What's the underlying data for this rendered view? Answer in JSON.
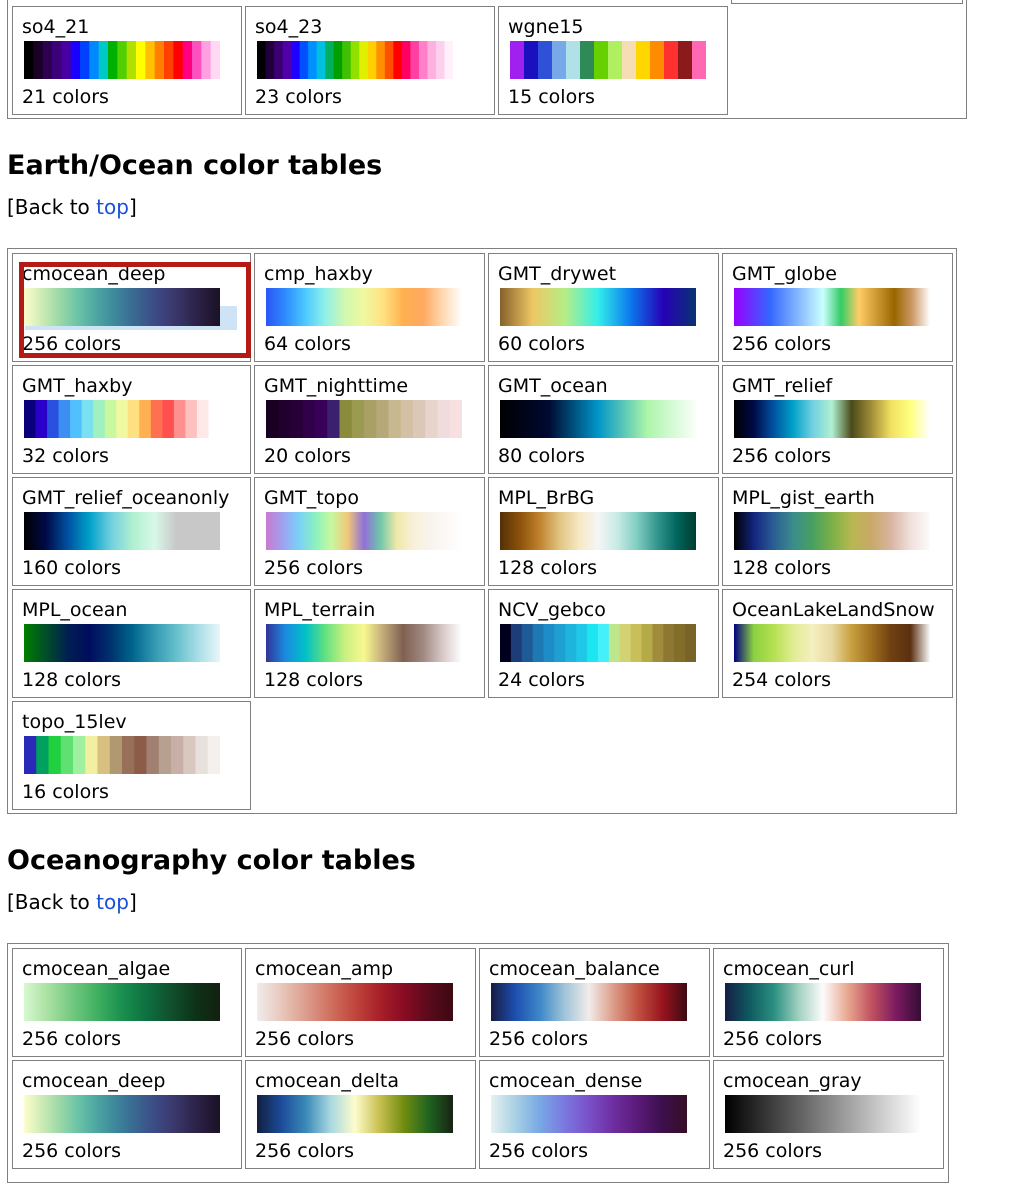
{
  "top_tables": [
    {
      "name": "so4_21",
      "count": "21 colors",
      "colors": [
        "#000000",
        "#1b0026",
        "#2e0050",
        "#3c0078",
        "#4800a0",
        "#1a00ff",
        "#0040ff",
        "#0088ff",
        "#00c8c8",
        "#00b000",
        "#50d000",
        "#b0e000",
        "#ffff00",
        "#ffc000",
        "#ff8000",
        "#ff4000",
        "#ff0000",
        "#ff0080",
        "#ff50c0",
        "#ffa0e0",
        "#ffd8f4"
      ],
      "fill": 1.0
    },
    {
      "name": "so4_23",
      "count": "23 colors",
      "colors": [
        "#000000",
        "#20003a",
        "#3a0070",
        "#5000a8",
        "#2000ff",
        "#0050ff",
        "#0090ff",
        "#00c0e0",
        "#00b060",
        "#00a000",
        "#40c000",
        "#90e000",
        "#e0f000",
        "#ffd000",
        "#ff9000",
        "#ff5000",
        "#ff0000",
        "#ff0060",
        "#ff40a0",
        "#ff80c8",
        "#ffb0e0",
        "#ffd0ee",
        "#fff0fa"
      ],
      "fill": 1.0
    },
    {
      "name": "wgne15",
      "count": "15 colors",
      "colors": [
        "#a020f0",
        "#1a10c0",
        "#3050d8",
        "#78a8e8",
        "#b0e0e8",
        "#2e8b57",
        "#66d000",
        "#b0f060",
        "#f5deb3",
        "#ffd700",
        "#ff8c00",
        "#ff3030",
        "#8b1a1a",
        "#ff69b4"
      ],
      "fill": 1.0
    }
  ],
  "sections": [
    {
      "title": "Earth/Ocean color tables",
      "back_prefix": "[Back to ",
      "back_link": "top",
      "back_suffix": "]",
      "tables": [
        {
          "name": "cmocean_deep",
          "count": "256 colors",
          "colors": [
            "#fdfecc",
            "#cdebb4",
            "#9cd8a8",
            "#6cc4a6",
            "#4ea8a2",
            "#3e8b9c",
            "#3a6e94",
            "#3c538a",
            "#3d3f77",
            "#332e5c",
            "#281d3f",
            "#1a1224"
          ],
          "smooth": true,
          "fill": 1.0,
          "highlight": true
        },
        {
          "name": "cmp_haxby",
          "count": "64 colors",
          "colors": [
            "#2a56f5",
            "#2f8cff",
            "#4cc8ff",
            "#8ff0e8",
            "#d0f8b0",
            "#f0f8a0",
            "#ffe080",
            "#ffb050",
            "#ffa860",
            "#ffd8b0",
            "#ffffff"
          ],
          "smooth": true,
          "fill": 1.0
        },
        {
          "name": "GMT_drywet",
          "count": "60 colors",
          "colors": [
            "#86612a",
            "#eec764",
            "#b4ee87",
            "#32eeeb",
            "#0c78ee",
            "#2601b7",
            "#083371"
          ],
          "smooth": true,
          "fill": 1.0
        },
        {
          "name": "GMT_globe",
          "count": "256 colors",
          "colors": [
            "#9900ff",
            "#6633ff",
            "#3366ff",
            "#6699ff",
            "#99ccff",
            "#ccffff",
            "#33cc66",
            "#ffcc66",
            "#cc9933",
            "#996600",
            "#cc9966",
            "#ffffff"
          ],
          "smooth": true,
          "fill": 1.0
        },
        {
          "name": "GMT_haxby",
          "count": "32 colors",
          "colors": [
            "#0a0079",
            "#2800c8",
            "#2a50e0",
            "#3c8ff0",
            "#50c0ff",
            "#78e0f0",
            "#a0f0c0",
            "#c8f8a0",
            "#f0f8a0",
            "#ffe080",
            "#ffb050",
            "#ff7050",
            "#ff5050",
            "#ff9090",
            "#ffc0c0",
            "#ffe8e8",
            "#ffffff"
          ],
          "fill": 1.0
        },
        {
          "name": "GMT_nighttime",
          "count": "20 colors",
          "colors": [
            "#1a0020",
            "#22002e",
            "#280038",
            "#300048",
            "#380058",
            "#3c2070",
            "#8a8b3c",
            "#9a9a50",
            "#a8a064",
            "#b8a878",
            "#c8b890",
            "#d4c0a4",
            "#dcc8b8",
            "#e8d4cc",
            "#f0dcdc",
            "#f8e0e0"
          ],
          "fill": 1.0
        },
        {
          "name": "GMT_ocean",
          "count": "80 colors",
          "colors": [
            "#000000",
            "#000519",
            "#000a32",
            "#00507d",
            "#0096c8",
            "#56c5b8",
            "#acf5a8",
            "#d3fad3",
            "#fafffa"
          ],
          "smooth": true,
          "fill": 1.0
        },
        {
          "name": "GMT_relief",
          "count": "256 colors",
          "colors": [
            "#000000",
            "#000a46",
            "#0050a0",
            "#00a0c8",
            "#70d0e0",
            "#b0f0d0",
            "#4a4a18",
            "#a08c38",
            "#f0e060",
            "#ffff80",
            "#ffffff"
          ],
          "smooth": true,
          "fill": 1.0
        },
        {
          "name": "GMT_relief_oceanonly",
          "count": "160 colors",
          "colors": [
            "#000000",
            "#000a46",
            "#0050a0",
            "#00a0c8",
            "#70d0e0",
            "#b0f0d0",
            "#d8f8e8",
            "#c8c8c8",
            "#c8c8c8",
            "#c8c8c8"
          ],
          "smooth": true,
          "fill": 1.0
        },
        {
          "name": "GMT_topo",
          "count": "256 colors",
          "colors": [
            "#c87ad0",
            "#a0a0f0",
            "#7ad0f8",
            "#8af0c0",
            "#c8f8a0",
            "#f0c878",
            "#9070d8",
            "#70c8a8",
            "#f0e8a8",
            "#f8f0d8",
            "#f8f4ec",
            "#fcf8f4",
            "#ffffff"
          ],
          "smooth": true,
          "fill": 1.0
        },
        {
          "name": "MPL_BrBG",
          "count": "128 colors",
          "colors": [
            "#543005",
            "#8c510a",
            "#bf812d",
            "#dfc27d",
            "#f6e8c3",
            "#f5f5f5",
            "#c7eae5",
            "#80cdc1",
            "#35978f",
            "#01665e",
            "#003c30"
          ],
          "smooth": true,
          "fill": 1.0
        },
        {
          "name": "MPL_gist_earth",
          "count": "128 colors",
          "colors": [
            "#000000",
            "#12247e",
            "#2a5c94",
            "#3a8c8c",
            "#48a060",
            "#7ab048",
            "#b8b850",
            "#c8a868",
            "#d8b4a0",
            "#f0e0dc",
            "#fdfbfb"
          ],
          "smooth": true,
          "fill": 1.0
        },
        {
          "name": "MPL_ocean",
          "count": "128 colors",
          "colors": [
            "#007f00",
            "#004f28",
            "#001f50",
            "#000c5e",
            "#00336e",
            "#00668c",
            "#3399b2",
            "#66c0cc",
            "#aadde6",
            "#e8f6fa"
          ],
          "smooth": true,
          "fill": 1.0
        },
        {
          "name": "MPL_terrain",
          "count": "128 colors",
          "colors": [
            "#333399",
            "#1a8ce0",
            "#00c0c8",
            "#60e080",
            "#c8f080",
            "#f8f890",
            "#c0a878",
            "#806050",
            "#a08880",
            "#d8c8c8",
            "#ffffff"
          ],
          "smooth": true,
          "fill": 1.0
        },
        {
          "name": "NCV_gebco",
          "count": "24 colors",
          "colors": [
            "#00001e",
            "#1e3c78",
            "#1e5a96",
            "#1e78b4",
            "#1e8cc8",
            "#1ea0d2",
            "#1eb4dc",
            "#1ec8e6",
            "#1ee6f0",
            "#46f0fa",
            "#bee68c",
            "#d2d272",
            "#c8be5a",
            "#b4aa46",
            "#a08c3c",
            "#8c7832",
            "#826e28",
            "#786428"
          ],
          "fill": 1.0
        },
        {
          "name": "OceanLakeLandSnow",
          "count": "254 colors",
          "colors": [
            "#000080",
            "#8cd040",
            "#b4e050",
            "#e0ec90",
            "#f4f0c0",
            "#e8d8a0",
            "#c8a040",
            "#a07020",
            "#704010",
            "#5a3010",
            "#fafafa"
          ],
          "smooth": true,
          "fill": 1.0
        },
        {
          "name": "topo_15lev",
          "count": "16 colors",
          "colors": [
            "#2a2ab8",
            "#00a060",
            "#20d040",
            "#60e070",
            "#a0f0a0",
            "#f0f0a0",
            "#d8c080",
            "#b09870",
            "#987058",
            "#8c5c48",
            "#a08070",
            "#b8a090",
            "#c8b0a8",
            "#d8c8c0",
            "#e8e0dc",
            "#f4f0ee"
          ],
          "fill": 1.0
        }
      ]
    },
    {
      "title": "Oceanography color tables",
      "back_prefix": "[Back to ",
      "back_link": "top",
      "back_suffix": "]",
      "tables": [
        {
          "name": "cmocean_algae",
          "count": "256 colors",
          "colors": [
            "#d7f9d0",
            "#a8e0a0",
            "#70c880",
            "#40b060",
            "#1a9050",
            "#0e7040",
            "#10502c",
            "#0e3218",
            "#12200f"
          ],
          "smooth": true,
          "fill": 1.0
        },
        {
          "name": "cmocean_amp",
          "count": "256 colors",
          "colors": [
            "#f1ecec",
            "#e8c8bc",
            "#dc9c8c",
            "#d07060",
            "#c0463c",
            "#a82028",
            "#880c24",
            "#5a0a1c",
            "#3c0912"
          ],
          "smooth": true,
          "fill": 1.0
        },
        {
          "name": "cmocean_balance",
          "count": "256 colors",
          "colors": [
            "#181c43",
            "#1d4fb0",
            "#3e88c8",
            "#a0c4d8",
            "#f1eceb",
            "#dc9c88",
            "#c05040",
            "#98141e",
            "#3c0912"
          ],
          "smooth": true,
          "fill": 1.0
        },
        {
          "name": "cmocean_curl",
          "count": "256 colors",
          "colors": [
            "#151d44",
            "#0f5a60",
            "#2a9080",
            "#a0d0c0",
            "#fefcfc",
            "#e8a890",
            "#c05060",
            "#7a1a60",
            "#340d35"
          ],
          "smooth": true,
          "fill": 1.0
        },
        {
          "name": "cmocean_deep",
          "count": "256 colors",
          "colors": [
            "#fdfecc",
            "#cdebb4",
            "#9cd8a8",
            "#6cc4a6",
            "#4ea8a2",
            "#3e8b9c",
            "#3a6e94",
            "#3c538a",
            "#3d3f77",
            "#332e5c",
            "#281d3f",
            "#1a1224"
          ],
          "smooth": true,
          "fill": 1.0
        },
        {
          "name": "cmocean_delta",
          "count": "256 colors",
          "colors": [
            "#112040",
            "#1c4c9a",
            "#3a8ab8",
            "#a8d8e0",
            "#fefccc",
            "#c8c050",
            "#708c10",
            "#206420",
            "#172313"
          ],
          "smooth": true,
          "fill": 1.0
        },
        {
          "name": "cmocean_dense",
          "count": "256 colors",
          "colors": [
            "#e6f1f1",
            "#a8d0e4",
            "#78a8e4",
            "#7a78e0",
            "#7a50c8",
            "#6e2ea0",
            "#5a1a78",
            "#3c0f4c",
            "#360e24"
          ],
          "smooth": true,
          "fill": 1.0
        },
        {
          "name": "cmocean_gray",
          "count": "256 colors",
          "colors": [
            "#000000",
            "#202020",
            "#404040",
            "#606060",
            "#808080",
            "#a0a0a0",
            "#c0c0c0",
            "#e0e0e0",
            "#ffffff"
          ],
          "smooth": true,
          "fill": 1.0
        }
      ]
    }
  ]
}
